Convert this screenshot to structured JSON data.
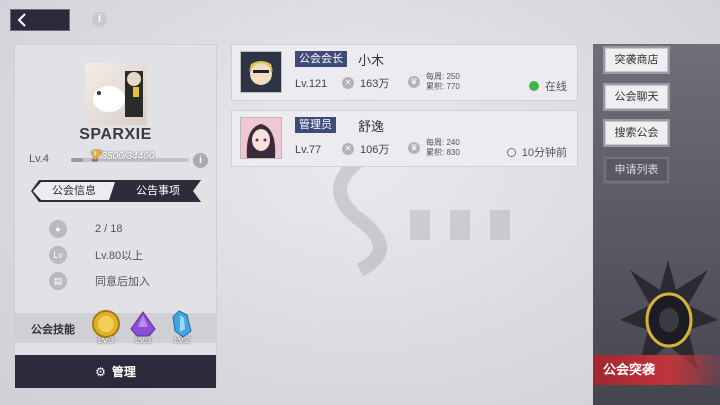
{
  "top": {
    "info_glyph": "i"
  },
  "guild": {
    "name": "SPARXIE",
    "level": "Lv.4",
    "exp_text": "3500/34400",
    "exp_fraction": 0.1,
    "exp_info_glyph": "i"
  },
  "tabs": {
    "info": "公会信息",
    "notice": "公告事项"
  },
  "details": [
    {
      "icon": "person-icon",
      "glyph": "👤",
      "value": "2 / 18"
    },
    {
      "icon": "level-icon",
      "glyph": "Lv",
      "value": "Lv.80以上"
    },
    {
      "icon": "join-icon",
      "glyph": "▤",
      "value": "同意后加入"
    }
  ],
  "skills": {
    "label": "公会技能",
    "items": [
      {
        "icon": "gold-coin-icon",
        "level": "Lv.3",
        "color": "#d9a520"
      },
      {
        "icon": "purple-crystal-icon",
        "level": "Lv.3",
        "color": "#8a4fd6"
      },
      {
        "icon": "blue-crystal-icon",
        "level": "Lv.2",
        "color": "#3fa6e0"
      }
    ]
  },
  "manage_button": {
    "icon": "gear-icon",
    "label": "管理"
  },
  "members": [
    {
      "role": "公会会长",
      "name": "小木",
      "level": "Lv.121",
      "power": "163万",
      "weekly_label": "每周: ",
      "weekly": "250",
      "total_label": "累积: ",
      "total": "770",
      "status": "在线",
      "online": true
    },
    {
      "role": "管理员",
      "name": "舒逸",
      "level": "Lv.77",
      "power": "106万",
      "weekly_label": "每周: ",
      "weekly": "240",
      "total_label": "累积: ",
      "total": "830",
      "status": "10分钟前",
      "online": false
    }
  ],
  "right_menu": {
    "raid_shop": "突袭商店",
    "guild_chat": "公会聊天",
    "search_guild": "搜索公会",
    "application_list": "申请列表"
  },
  "raid_banner": "公会突袭",
  "colors": {
    "accent_dark": "#2b2b3c",
    "role_badge": "#3d4a7a",
    "online": "#43b64a",
    "raid": "#c2343c"
  }
}
